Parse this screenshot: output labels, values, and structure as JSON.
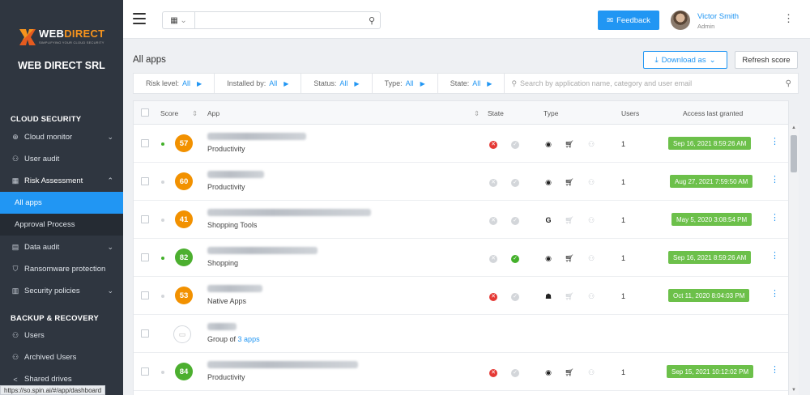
{
  "brand": {
    "name_part1": "WEB",
    "name_part2": "DIRECT",
    "tagline": "SIMPLIFYING YOUR CLOUD SECURITY"
  },
  "org_name": "WEB DIRECT SRL",
  "sidebar": {
    "section_cloud": "CLOUD SECURITY",
    "section_backup": "BACKUP & RECOVERY",
    "items": [
      {
        "label": "Cloud monitor"
      },
      {
        "label": "User audit"
      },
      {
        "label": "Risk Assessment"
      },
      {
        "label": "All apps"
      },
      {
        "label": "Approval Process"
      },
      {
        "label": "Data audit"
      },
      {
        "label": "Ransomware protection"
      },
      {
        "label": "Security policies"
      },
      {
        "label": "Users"
      },
      {
        "label": "Archived Users"
      },
      {
        "label": "Shared drives"
      }
    ]
  },
  "status_url": "https://so.spin.ai/#/app/dashboard",
  "topbar": {
    "feedback_label": "Feedback",
    "user_name": "Victor Smith",
    "user_role": "Admin",
    "search_value": ""
  },
  "page": {
    "title": "All apps",
    "download_label": "Download as",
    "refresh_label": "Refresh score"
  },
  "filters": [
    {
      "label": "Risk level:",
      "value": "All"
    },
    {
      "label": "Installed by:",
      "value": "All"
    },
    {
      "label": "Status:",
      "value": "All"
    },
    {
      "label": "Type:",
      "value": "All"
    },
    {
      "label": "State:",
      "value": "All"
    }
  ],
  "filter_search_placeholder": "Search by application name, category and user email",
  "table": {
    "headers": {
      "score": "Score",
      "app": "App",
      "state": "State",
      "type": "Type",
      "users": "Users",
      "granted": "Access last granted"
    },
    "rows": [
      {
        "score": "57",
        "category": "Productivity",
        "users": "1",
        "granted": "Sep 16, 2021 8:59:26 AM"
      },
      {
        "score": "60",
        "category": "Productivity",
        "users": "1",
        "granted": "Aug 27, 2021 7:59:50 AM"
      },
      {
        "score": "41",
        "category": "Shopping Tools",
        "users": "1",
        "granted": "May 5, 2020 3:08:54 PM"
      },
      {
        "score": "82",
        "category": "Shopping",
        "users": "1",
        "granted": "Sep 16, 2021 8:59:26 AM"
      },
      {
        "score": "53",
        "category": "Native Apps",
        "users": "1",
        "granted": "Oct 11, 2020 8:04:03 PM"
      },
      {
        "group_prefix": "Group of",
        "group_link": "3 apps"
      },
      {
        "score": "84",
        "category": "Productivity",
        "users": "1",
        "granted": "Sep 15, 2021 10:12:02 PM"
      }
    ]
  },
  "colors": {
    "accent": "#2196f3",
    "orange_score": "#f29100",
    "green_score": "#4caf2f",
    "granted_bg": "#6cc04a",
    "state_red": "#e53935",
    "state_green": "#43b02a"
  }
}
